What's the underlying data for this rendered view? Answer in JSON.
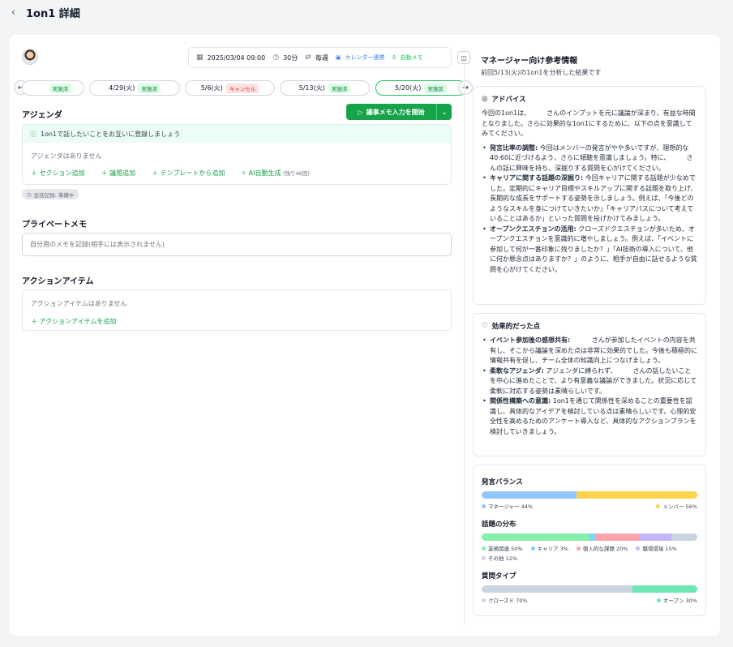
{
  "page": {
    "back_icon": "chevron-left",
    "title": "1on1 詳細"
  },
  "meeting": {
    "datetime": "2025/03/04 09:00",
    "duration": "30分",
    "repeat": "毎週",
    "calendar_label": "カレンダー連携",
    "auto_memo_label": "自動メモ"
  },
  "sessions": [
    {
      "date": "",
      "status": "実施済",
      "status_type": "done",
      "active": false
    },
    {
      "date": "4/29(火)",
      "status": "実施済",
      "status_type": "done",
      "active": false
    },
    {
      "date": "5/6(火)",
      "status": "キャンセル",
      "status_type": "cancel",
      "active": false
    },
    {
      "date": "5/13(火)",
      "status": "実施済",
      "status_type": "done",
      "active": false
    },
    {
      "date": "5/20(火)",
      "status": "実施前",
      "status_type": "done",
      "active": true
    }
  ],
  "agenda": {
    "heading": "アジェンダ",
    "start_button": "議事メモ入力を開始",
    "hint": "1on1で話したいことをお互いに登録しましょう",
    "empty": "アジェンダはありません",
    "actions": {
      "add_section": "セクション追加",
      "add_topic": "議題追加",
      "from_template": "テンプレートから追加",
      "ai_generate": "AI自動生成",
      "ai_remaining": "(残り46回)"
    },
    "record_status": "会話記録: 準備中"
  },
  "private_memo": {
    "heading": "プライベートメモ",
    "placeholder": "自分用のメモを記録(相手には表示されません)"
  },
  "action_items": {
    "heading": "アクションアイテム",
    "empty": "アクションアイテムはありません",
    "add": "アクションアイテムを追加"
  },
  "manager_panel": {
    "title": "マネージャー向け参考情報",
    "subtitle": "前回5/13(火)の1on1を分析した結果です",
    "advice": {
      "heading": "アドバイス",
      "intro": "今回の1on1は、　　　さんのインプットを元に議論が深まり、有益な時間となりました。さらに効果的な1on1にするために、以下の点を意識してみてください。",
      "items": [
        {
          "title": "発言比率の調整:",
          "text": " 今回はメンバーの発言がやや多いですが、理想的な40:60に近づけるよう、さらに傾聴を意識しましょう。特に、　　　さんの話に興味を持ち、深掘りする質問を心がけてください。"
        },
        {
          "title": "キャリアに関する話題の深掘り:",
          "text": " 今回キャリアに関する話題が少なめでした。定期的にキャリア目標やスキルアップに関する話題を取り上げ、長期的な成長をサポートする姿勢を示しましょう。例えば、「今後どのようなスキルを身につけていきたいか」「キャリアパスについて考えていることはあるか」といった質問を投げかけてみましょう。"
        },
        {
          "title": "オープンクエスチョンの活用:",
          "text": " クローズドクエスチョンが多いため、オープンクエスチョンを意識的に増やしましょう。例えば、「イベントに参加して何が一番印象に残りましたか？」「AI技術の導入について、他に何か懸念点はありますか？」のように、相手が自由に話せるような質問を心がけてください。"
        }
      ]
    },
    "effective": {
      "heading": "効果的だった点",
      "items": [
        {
          "title": "イベント参加後の感想共有:",
          "text": " 　　　さんが参加したイベントの内容を共有し、そこから議論を深めた点は非常に効果的でした。今後も積極的に情報共有を促し、チーム全体の知識向上につなげましょう。"
        },
        {
          "title": "柔軟なアジェンダ:",
          "text": " アジェンダに縛られず、　　　さんの話したいことを中心に進めたことで、より有意義な議論ができました。状況に応じて柔軟に対応する姿勢は素晴らしいです。"
        },
        {
          "title": "関係性構築への意識:",
          "text": " 1on1を通じて関係性を深めることの重要性を認識し、具体的なアイデアを検討している点は素晴らしいです。心理的安全性を高めるためのアンケート導入など、具体的なアクションプランを検討していきましょう。"
        }
      ]
    },
    "stats": {
      "speech_balance": {
        "heading": "発言バランス",
        "segments": [
          {
            "label": "マネージャー 44%",
            "value": 44,
            "color": "#93c5fd"
          },
          {
            "label": "メンバー 56%",
            "value": 56,
            "color": "#fcd34d"
          }
        ]
      },
      "topic_distribution": {
        "heading": "話題の分布",
        "segments": [
          {
            "label": "業務関連 50%",
            "value": 50,
            "color": "#86efac"
          },
          {
            "label": "キャリア 3%",
            "value": 3,
            "color": "#7dd3fc"
          },
          {
            "label": "個人的な課題 20%",
            "value": 20,
            "color": "#fda4af"
          },
          {
            "label": "職場環境 15%",
            "value": 15,
            "color": "#c4b5fd"
          },
          {
            "label": "その他 12%",
            "value": 12,
            "color": "#cbd5e1"
          }
        ]
      },
      "question_type": {
        "heading": "質問タイプ",
        "segments": [
          {
            "label": "クローズド 70%",
            "value": 70,
            "color": "#cbd5e1"
          },
          {
            "label": "オープン 30%",
            "value": 30,
            "color": "#6ee7b7"
          }
        ]
      }
    }
  }
}
